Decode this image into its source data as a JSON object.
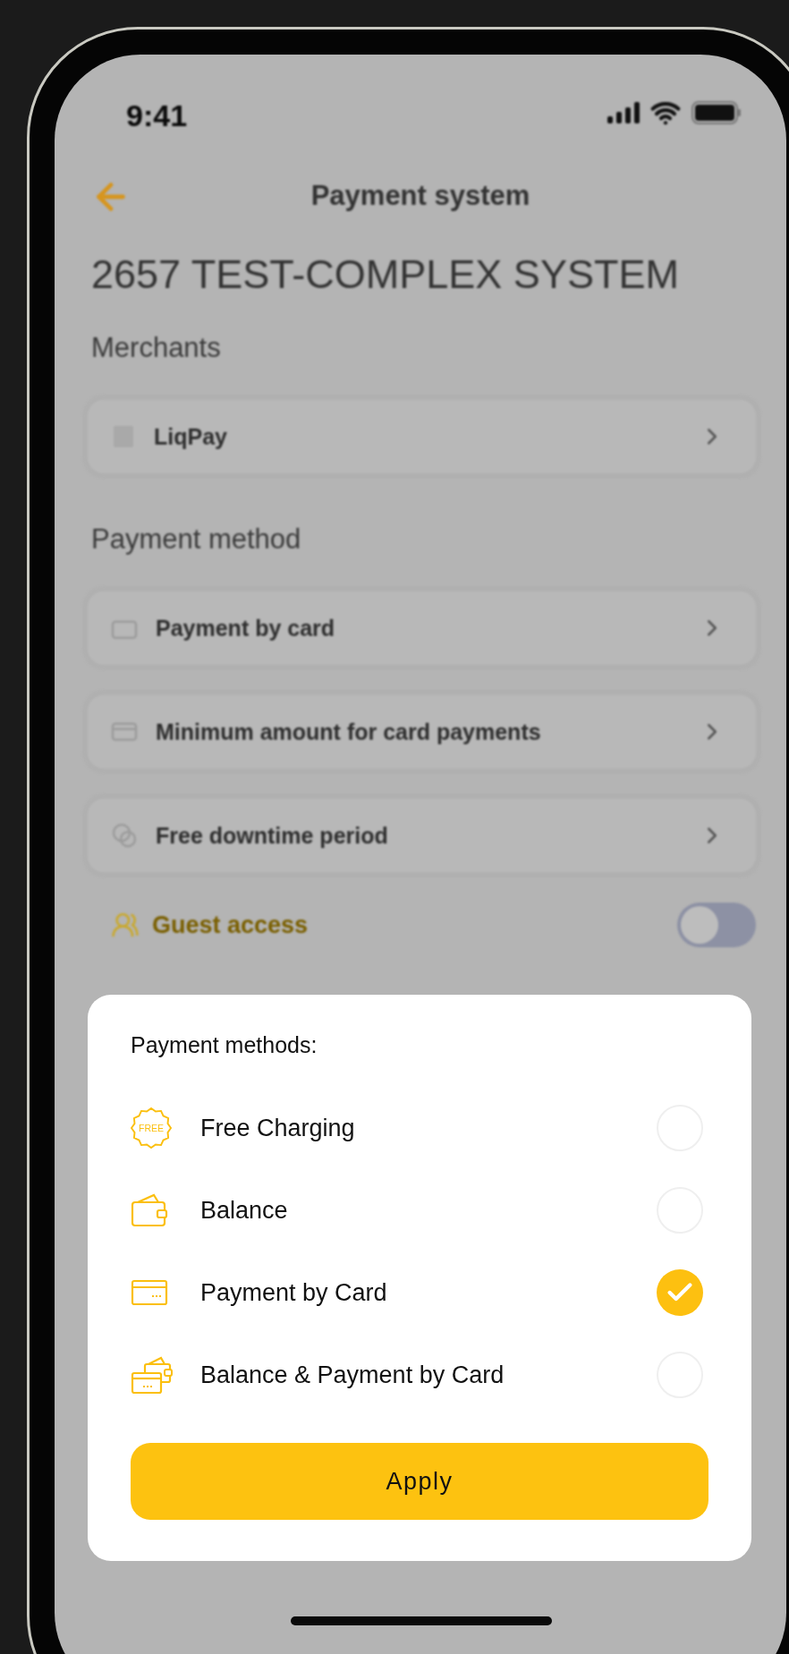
{
  "status_bar": {
    "time": "9:41"
  },
  "header": {
    "title": "Payment system"
  },
  "heading": "2657 TEST-COMPLEX SYSTEM",
  "merchants": {
    "title": "Merchants",
    "items": [
      {
        "label": "LiqPay"
      }
    ]
  },
  "payment_method": {
    "title": "Payment method",
    "items": [
      {
        "label": "Payment by card"
      },
      {
        "label": "Minimum amount for card payments"
      },
      {
        "label": "Free downtime period"
      }
    ]
  },
  "guest_access": {
    "label": "Guest access",
    "on": false
  },
  "modal": {
    "title": "Payment methods:",
    "options": [
      {
        "label": "Free Charging",
        "selected": false,
        "icon_text": "FREE"
      },
      {
        "label": "Balance",
        "selected": false
      },
      {
        "label": "Payment by Card",
        "selected": true
      },
      {
        "label": "Balance & Payment by Card",
        "selected": false
      }
    ],
    "apply_button": "Apply"
  }
}
